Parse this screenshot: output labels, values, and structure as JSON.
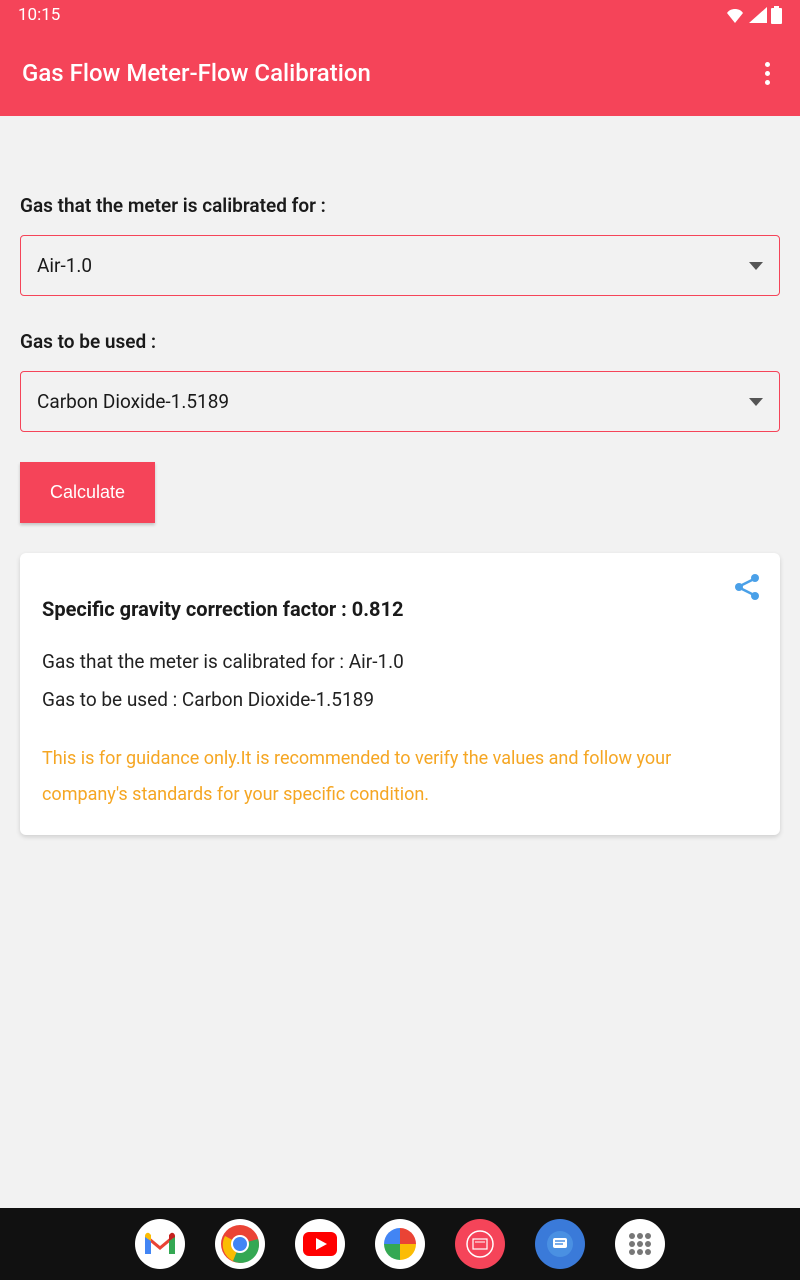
{
  "status_bar": {
    "time": "10:15"
  },
  "app_bar": {
    "title": "Gas Flow Meter-Flow Calibration"
  },
  "form": {
    "label1": "Gas that the meter is calibrated for :",
    "dropdown1_value": "Air-1.0",
    "label2": "Gas to be used :",
    "dropdown2_value": "Carbon Dioxide-1.5189",
    "calculate_label": "Calculate"
  },
  "result": {
    "title": "Specific gravity correction factor : 0.812",
    "line1": "Gas that the meter is calibrated for : Air-1.0",
    "line2": "Gas to be used : Carbon Dioxide-1.5189",
    "disclaimer": "This is for guidance only.It is recommended to verify the values and follow your company's standards for your specific condition."
  }
}
